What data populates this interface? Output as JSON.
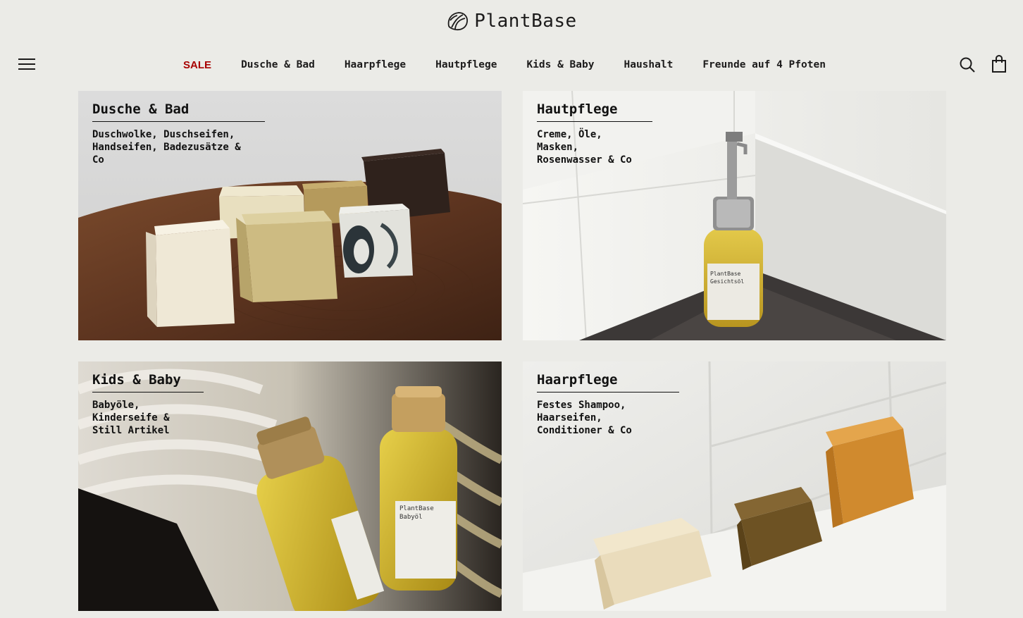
{
  "brand": {
    "name": "PlantBase",
    "logo_icon": "leaf-logo-icon"
  },
  "header": {
    "menu_icon": "hamburger-menu-icon",
    "search_icon": "search-icon",
    "cart_icon": "shopping-bag-icon",
    "nav": [
      {
        "label": "SALE",
        "color": "#a80000"
      },
      {
        "label": "Dusche & Bad"
      },
      {
        "label": "Haarpflege"
      },
      {
        "label": "Hautpflege"
      },
      {
        "label": "Kids & Baby"
      },
      {
        "label": "Haushalt"
      },
      {
        "label": "Freunde auf 4 Pfoten"
      }
    ]
  },
  "categories": [
    {
      "title": "Dusche & Bad",
      "description": "Duschwolke, Duschseifen,\nHandseifen, Badezusätze &\nCo"
    },
    {
      "title": "Hautpflege",
      "description": "Creme, Öle,\nMasken,\nRosenwasser & Co"
    },
    {
      "title": "Kids & Baby",
      "description": "Babyöle,\nKinderseife &\nStill Artikel"
    },
    {
      "title": "Haarpflege",
      "description": "Festes Shampoo,\nHaarseifen,\nConditioner & Co"
    }
  ],
  "product_labels": {
    "gesichtsoel_brand": "PlantBase",
    "gesichtsoel_name": "Gesichtsöl",
    "babyoel_brand": "PlantBase",
    "babyoel_name": "Babyöl"
  },
  "colors": {
    "background": "#ebebe7",
    "text": "#1c1b1b",
    "sale": "#a80000"
  }
}
